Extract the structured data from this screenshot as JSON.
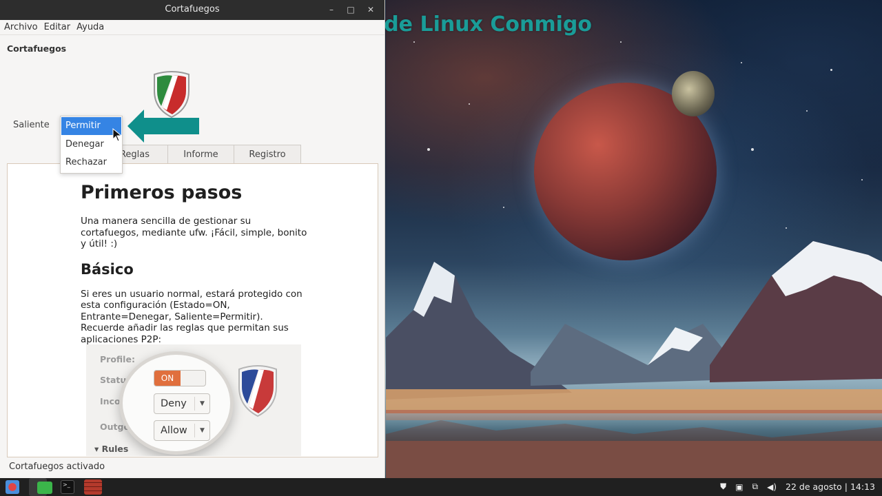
{
  "window": {
    "title": "Cortafuegos",
    "controls": {
      "minimize": "–",
      "maximize": "□",
      "close": "✕"
    }
  },
  "menu": {
    "archivo": "Archivo",
    "editar": "Editar",
    "ayuda": "Ayuda"
  },
  "section_title": "Cortafuegos",
  "saliente_label": "Saliente",
  "dropdown": {
    "options": [
      "Permitir",
      "Denegar",
      "Rechazar"
    ],
    "selected": "Permitir"
  },
  "tabs": [
    "Reglas",
    "Informe",
    "Registro"
  ],
  "doc": {
    "heading": "Primeros pasos",
    "intro": "Una manera sencilla de gestionar su cortafuegos, mediante ufw. ¡Fácil, simple, bonito y útil! :)",
    "subheading": "Básico",
    "body": "Si eres un usuario normal, estará protegido con esta configuración (Estado=ON, Entrante=Denegar, Saliente=Permitir). Recuerde añadir las reglas que permitan sus aplicaciones P2P:"
  },
  "illustration": {
    "profile_label": "Profile:",
    "status_label": "Status:",
    "incoming_label": "Incoming:",
    "outgoing_label": "Outgoing:",
    "rules_label": "▾ Rules",
    "toggle_on": "ON",
    "incoming_value": "Deny",
    "outgoing_value": "Allow"
  },
  "status_bar": "Cortafuegos activado",
  "watermark": "Aprende Linux Conmigo",
  "taskbar": {
    "icons": [
      "menu-icon",
      "files-icon",
      "terminal-icon",
      "firewall-icon"
    ],
    "terminal_glyph": ">_",
    "tray_icons": [
      "shield-icon",
      "printer-icon",
      "network-icon",
      "volume-icon"
    ],
    "datetime": "22 de agosto | 14:13"
  },
  "colors": {
    "accent_selection": "#3584e4",
    "watermark_teal": "#1a9c98",
    "arrow_teal": "#0f8f8b",
    "toggle_on": "#e06f3d"
  }
}
